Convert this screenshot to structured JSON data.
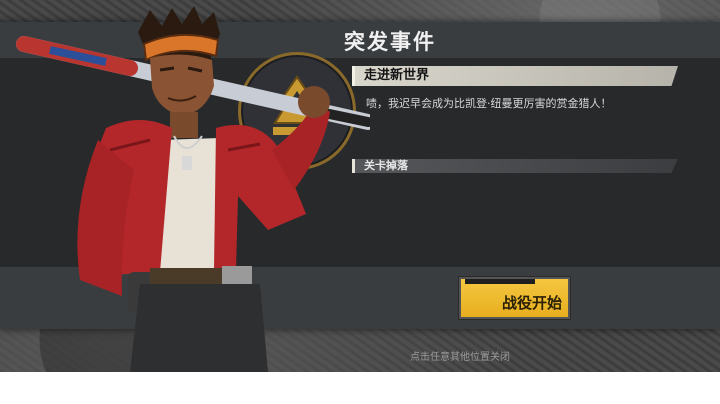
{
  "dialog": {
    "title": "突发事件",
    "stage_name": "走进新世界",
    "description": "啧，我迟早会成为比凯登·纽曼更厉害的赏金猎人！",
    "drops_label": "关卡掉落",
    "start_button": "战役开始",
    "close_hint": "点击任意其他位置关闭"
  },
  "colors": {
    "panel": "#28292b",
    "title_bar": "#3a3d40",
    "button": "#f5c842",
    "section_head": "#d9d6cc"
  },
  "icons": {
    "emblem": "faction-emblem-icon",
    "character": "character-portrait"
  }
}
